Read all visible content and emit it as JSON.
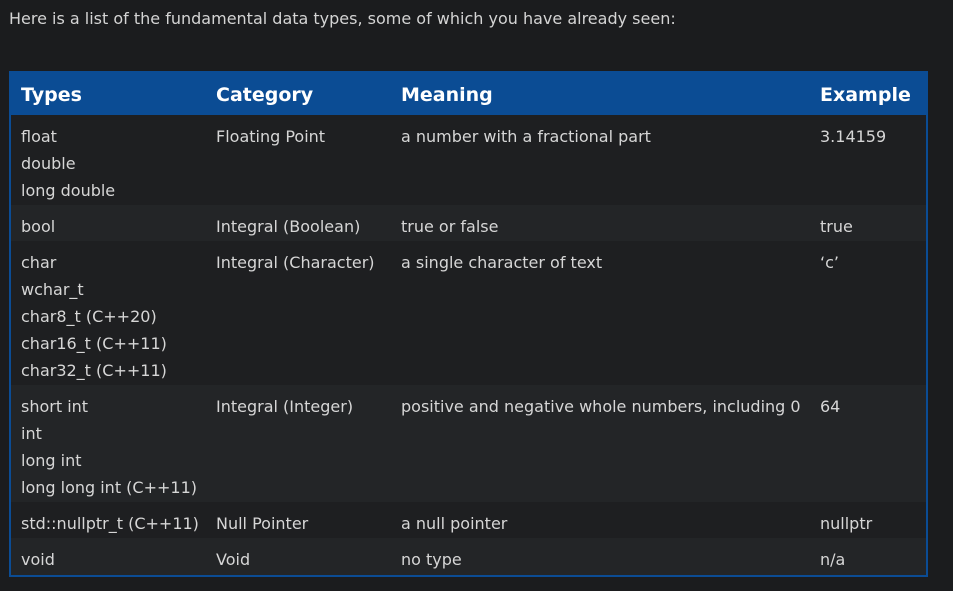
{
  "intro": "Here is a list of the fundamental data types, some of which you have already seen:",
  "table": {
    "headers": [
      "Types",
      "Category",
      "Meaning",
      "Example"
    ],
    "rows": [
      {
        "types": [
          "float",
          "double",
          "long double"
        ],
        "category": "Floating Point",
        "meaning": "a number with a fractional part",
        "example": "3.14159"
      },
      {
        "types": [
          "bool"
        ],
        "category": "Integral (Boolean)",
        "meaning": "true or false",
        "example": "true"
      },
      {
        "types": [
          "char",
          "wchar_t",
          "char8_t (C++20)",
          "char16_t (C++11)",
          "char32_t (C++11)"
        ],
        "category": "Integral (Character)",
        "meaning": "a single character of text",
        "example": "‘c’"
      },
      {
        "types": [
          "short int",
          "int",
          "long int",
          "long long int (C++11)"
        ],
        "category": "Integral (Integer)",
        "meaning": "positive and negative whole numbers, including 0",
        "example": "64"
      },
      {
        "types": [
          "std::nullptr_t (C++11)"
        ],
        "category": "Null Pointer",
        "meaning": "a null pointer",
        "example": "nullptr"
      },
      {
        "types": [
          "void"
        ],
        "category": "Void",
        "meaning": "no type",
        "example": "n/a"
      }
    ]
  },
  "colors": {
    "header_bg": "#0b4c94",
    "page_bg": "#1b1c1e",
    "row_bg": "#1e1f21",
    "row_alt_bg": "#232527"
  }
}
